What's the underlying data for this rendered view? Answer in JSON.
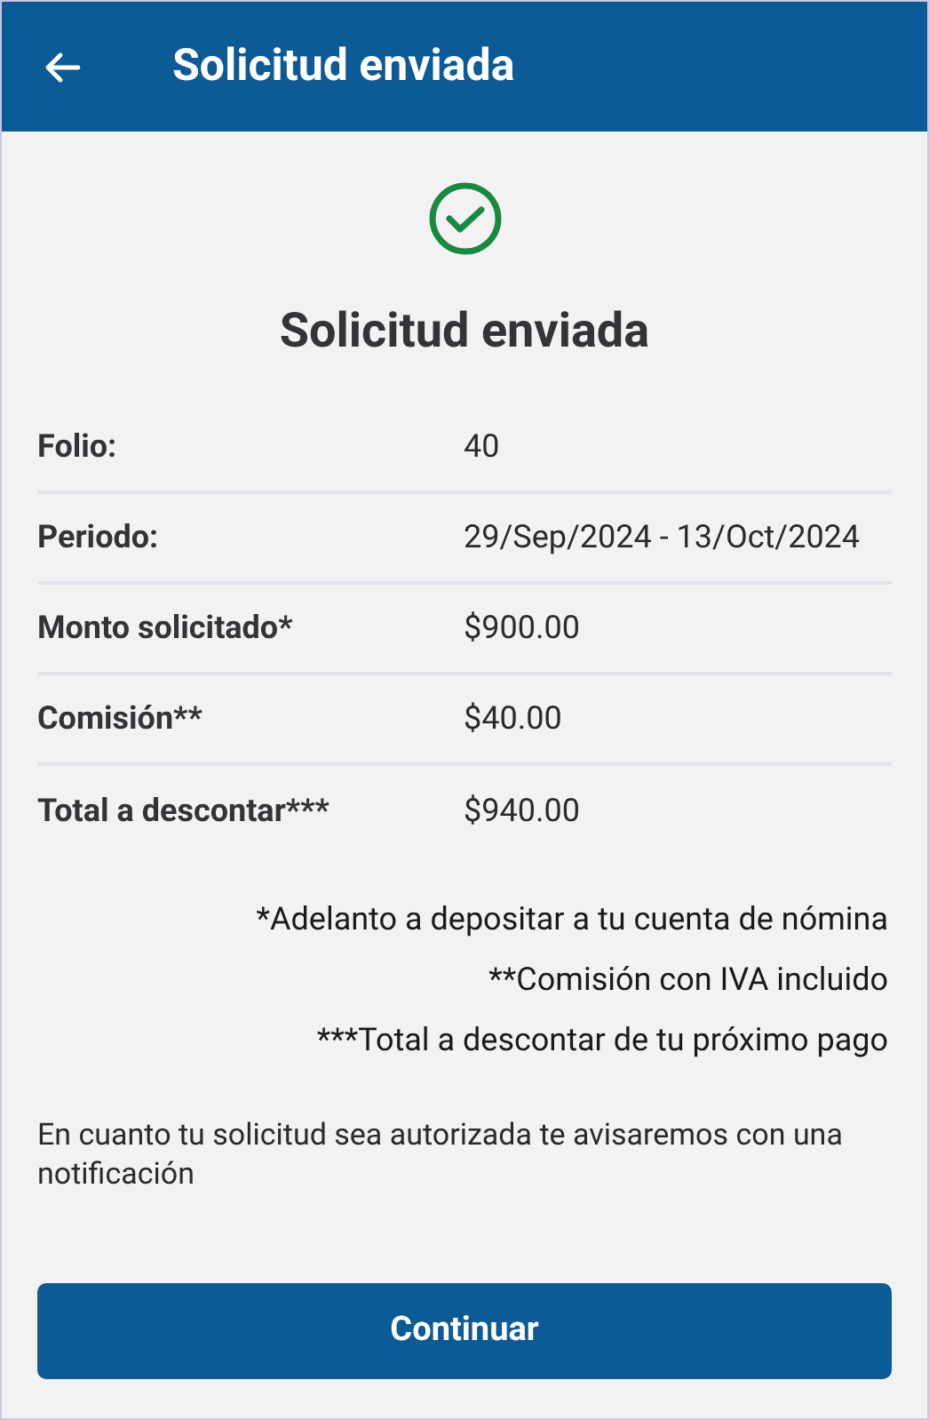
{
  "header": {
    "title": "Solicitud enviada"
  },
  "heading": "Solicitud enviada",
  "details": [
    {
      "label": "Folio:",
      "value": "40"
    },
    {
      "label": "Periodo:",
      "value": "29/Sep/2024 - 13/Oct/2024"
    },
    {
      "label": "Monto solicitado*",
      "value": "$900.00"
    },
    {
      "label": "Comisión**",
      "value": "$40.00"
    },
    {
      "label": "Total a descontar***",
      "value": "$940.00"
    }
  ],
  "footnotes": [
    "*Adelanto a depositar a tu cuenta de nómina",
    "**Comisión con IVA incluido",
    "***Total a descontar de tu próximo pago"
  ],
  "message": "En cuanto tu solicitud sea autorizada te avisaremos con una notificación",
  "button": "Continuar"
}
